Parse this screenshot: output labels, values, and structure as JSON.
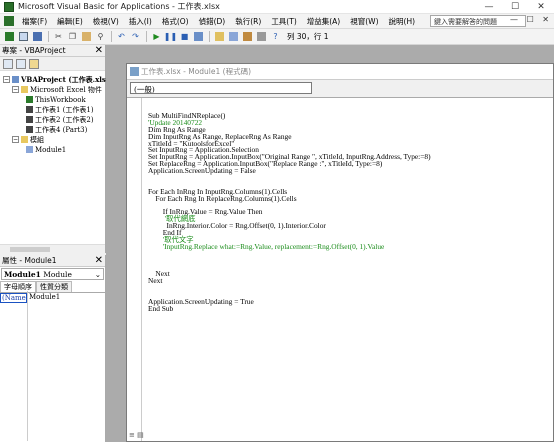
{
  "window": {
    "title": "Microsoft Visual Basic for Applications - 工作表.xlsx",
    "controls": [
      "—",
      "☐",
      "✕"
    ]
  },
  "menu": {
    "items": [
      "檔案(F)",
      "編輯(E)",
      "檢視(V)",
      "插入(I)",
      "格式(O)",
      "偵錯(D)",
      "執行(R)",
      "工具(T)",
      "增益集(A)",
      "視窗(W)",
      "說明(H)"
    ],
    "help_placeholder": "鍵入需要解答的問題",
    "mdi_controls": "— ☐ ✕"
  },
  "toolbar": {
    "cursor_position": "列 30，行 1"
  },
  "project": {
    "title": "專案 - VBAProject",
    "tree": [
      {
        "label": "VBAProject (工作表.xls",
        "bold": true
      },
      {
        "label": "Microsoft Excel 物件"
      },
      {
        "label": "ThisWorkbook"
      },
      {
        "label": "工作表1 (工作表1)"
      },
      {
        "label": "工作表2 (工作表2)"
      },
      {
        "label": "工作表4 (Part3)"
      },
      {
        "label": "模組"
      },
      {
        "label": "Module1"
      }
    ]
  },
  "properties": {
    "title": "屬性 - Module1",
    "selected_object": "Module1",
    "selected_type": "Module",
    "tabs": [
      "字母順序",
      "性質分類"
    ],
    "rows": [
      {
        "key": "(Name)",
        "value": "Module1"
      }
    ]
  },
  "code_window": {
    "title": "工作表.xlsx - Module1 (程式碼)",
    "object_combo": "(一般)",
    "lines": [
      {
        "text": "Sub MultiFindNReplace()",
        "comment": false
      },
      {
        "text": "'Update 20140722",
        "comment": true
      },
      {
        "text": "Dim Rng As Range",
        "comment": false
      },
      {
        "text": "Dim InputRng As Range, ReplaceRng As Range",
        "comment": false
      },
      {
        "text": "xTitleId = \"KutoolsforExcel\"",
        "comment": false
      },
      {
        "text": "Set InputRng = Application.Selection",
        "comment": false
      },
      {
        "text": "Set InputRng = Application.InputBox(\"Original Range \", xTitleId, InputRng.Address, Type:=8)",
        "comment": false
      },
      {
        "text": "Set ReplaceRng = Application.InputBox(\"Replace Range :\", xTitleId, Type:=8)",
        "comment": false
      },
      {
        "text": "Application.ScreenUpdating = False",
        "comment": false
      },
      {
        "text": "",
        "comment": false
      },
      {
        "text": "",
        "comment": false
      },
      {
        "text": "For Each InRng In InputRng.Columns(1).Cells",
        "comment": false
      },
      {
        "text": "    For Each Rng In ReplaceRng.Columns(1).Cells",
        "comment": false
      },
      {
        "text": "",
        "comment": false
      },
      {
        "text": "        If InRng.Value = Rng.Value Then",
        "comment": false
      },
      {
        "text": "         '取代網底",
        "comment": true
      },
      {
        "text": "          InRng.Interior.Color = Rng.Offset(0, 1).Interior.Color",
        "comment": false
      },
      {
        "text": "        End If",
        "comment": false
      },
      {
        "text": "        '取代文字",
        "comment": true
      },
      {
        "text": "        'InputRng.Replace what:=Rng.Value, replacement:=Rng.Offset(0, 1).Value",
        "comment": true
      },
      {
        "text": "",
        "comment": false
      },
      {
        "text": "",
        "comment": false
      },
      {
        "text": "",
        "comment": false
      },
      {
        "text": "    Next",
        "comment": false
      },
      {
        "text": "Next",
        "comment": false
      },
      {
        "text": "",
        "comment": false
      },
      {
        "text": "",
        "comment": false
      },
      {
        "text": "Application.ScreenUpdating = True",
        "comment": false
      },
      {
        "text": "End Sub",
        "comment": false
      }
    ]
  }
}
